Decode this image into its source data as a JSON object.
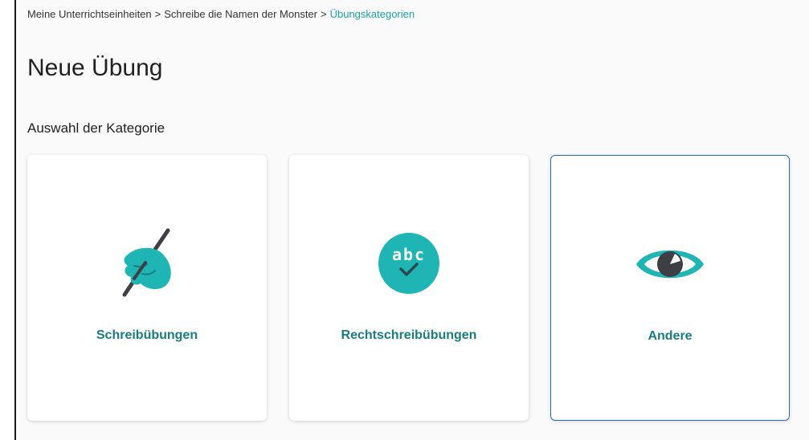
{
  "breadcrumb": {
    "items": [
      {
        "label": "Meine Unterrichtseinheiten"
      },
      {
        "label": "Schreibe die Namen der Monster"
      },
      {
        "label": "Übungskategorien"
      }
    ],
    "separator": ">"
  },
  "page": {
    "title": "Neue Übung",
    "subtitle": "Auswahl der Kategorie"
  },
  "categories": [
    {
      "label": "Schreibübungen",
      "icon": "writing-hand-icon",
      "selected": false
    },
    {
      "label": "Rechtschreibübungen",
      "icon": "abc-check-icon",
      "icon_text": "abc",
      "selected": false
    },
    {
      "label": "Andere",
      "icon": "eye-icon",
      "selected": true
    }
  ],
  "colors": {
    "accent": "#19a3a8",
    "label": "#187c81",
    "selected_border": "#2a6db5",
    "icon_dark": "#3d3f44"
  }
}
